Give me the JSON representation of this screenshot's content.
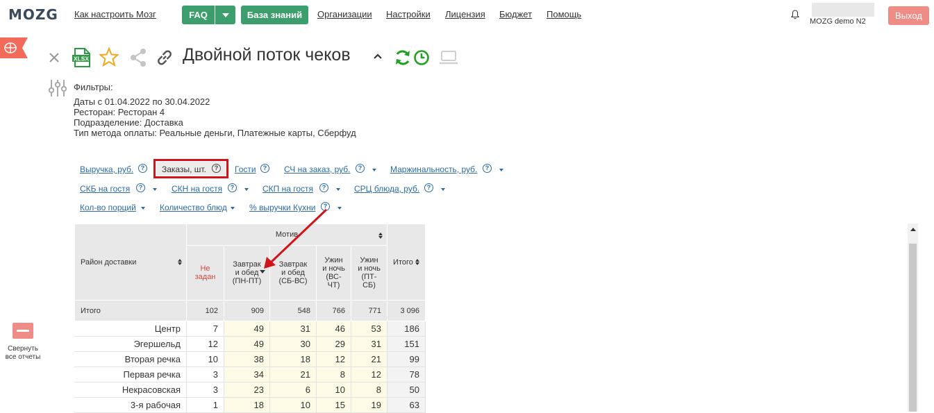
{
  "nav": {
    "logo": "MOZG",
    "links": [
      "Как настроить Мозг",
      "Организации",
      "Настройки",
      "Лицензия",
      "Бюджет",
      "Помощь"
    ],
    "faq_label": "FAQ",
    "kb_label": "База знаний",
    "user_name": "MOZG demo N2",
    "exit_label": "Выход"
  },
  "report": {
    "title": "Двойной поток чеков",
    "filters_label": "Фильтры:",
    "filters": [
      {
        "key": "Даты",
        "value": " с 01.04.2022 по 30.04.2022"
      },
      {
        "key": "Ресторан:",
        "value": " Ресторан 4"
      },
      {
        "key": "Подразделение:",
        "value": " Доставка"
      },
      {
        "key": "Тип метода оплаты:",
        "value": " Реальные деньги, Платежные карты, Сберфуд"
      }
    ],
    "xlsx_label": "XLSX"
  },
  "metrics": {
    "revenue": "Выручка, руб.",
    "orders": "Заказы, шт.",
    "guests": "Гости",
    "avg_check": "СЧ на заказ, руб.",
    "margin": "Маржинальность, руб.",
    "skb": "СКБ на гостя",
    "skn": "СКН на гостя",
    "skp": "СКП на гостя",
    "src": "СРЦ блюда, руб.",
    "portions": "Кол-во порций",
    "dishes": "Количество блюд",
    "kitchen_share": "% выручки Кухни"
  },
  "sidebar": {
    "collapse_label_1": "Свернуть",
    "collapse_label_2": "все отчеты"
  },
  "table": {
    "row_header": "Район доставки",
    "group_header": "Мотив",
    "total_header": "Итого",
    "columns": [
      {
        "label": "Не задан",
        "red": true
      },
      {
        "label": "Завтрак и обед (ПН-ПТ)",
        "sorted": true
      },
      {
        "label": "Завтрак и обед (СБ-ВС)"
      },
      {
        "label": "Ужин и ночь (ВС-ЧТ)"
      },
      {
        "label": "Ужин и ночь (ПТ-СБ)"
      }
    ],
    "total_row": {
      "label": "Итого",
      "values": [
        "102",
        "909",
        "548",
        "766",
        "771"
      ],
      "total": "3 096"
    },
    "rows": [
      {
        "label": "Центр",
        "values": [
          "7",
          "49",
          "31",
          "46",
          "53"
        ],
        "total": "186"
      },
      {
        "label": "Эгершельд",
        "values": [
          "12",
          "49",
          "30",
          "29",
          "31"
        ],
        "total": "151"
      },
      {
        "label": "Вторая речка",
        "values": [
          "10",
          "38",
          "18",
          "12",
          "21"
        ],
        "total": "99"
      },
      {
        "label": "Первая речка",
        "values": [
          "3",
          "34",
          "21",
          "8",
          "12"
        ],
        "total": "78"
      },
      {
        "label": "Некрасовская",
        "values": [
          "3",
          "23",
          "6",
          "10",
          "8"
        ],
        "total": "50"
      },
      {
        "label": "3-я рабочая",
        "values": [
          "1",
          "18",
          "10",
          "15",
          "19"
        ],
        "total": "63"
      }
    ]
  },
  "colors": {
    "green": "#3c9e6c",
    "exit": "#f08c86",
    "link": "#2a6ba8",
    "highlight": "#d0141a"
  }
}
